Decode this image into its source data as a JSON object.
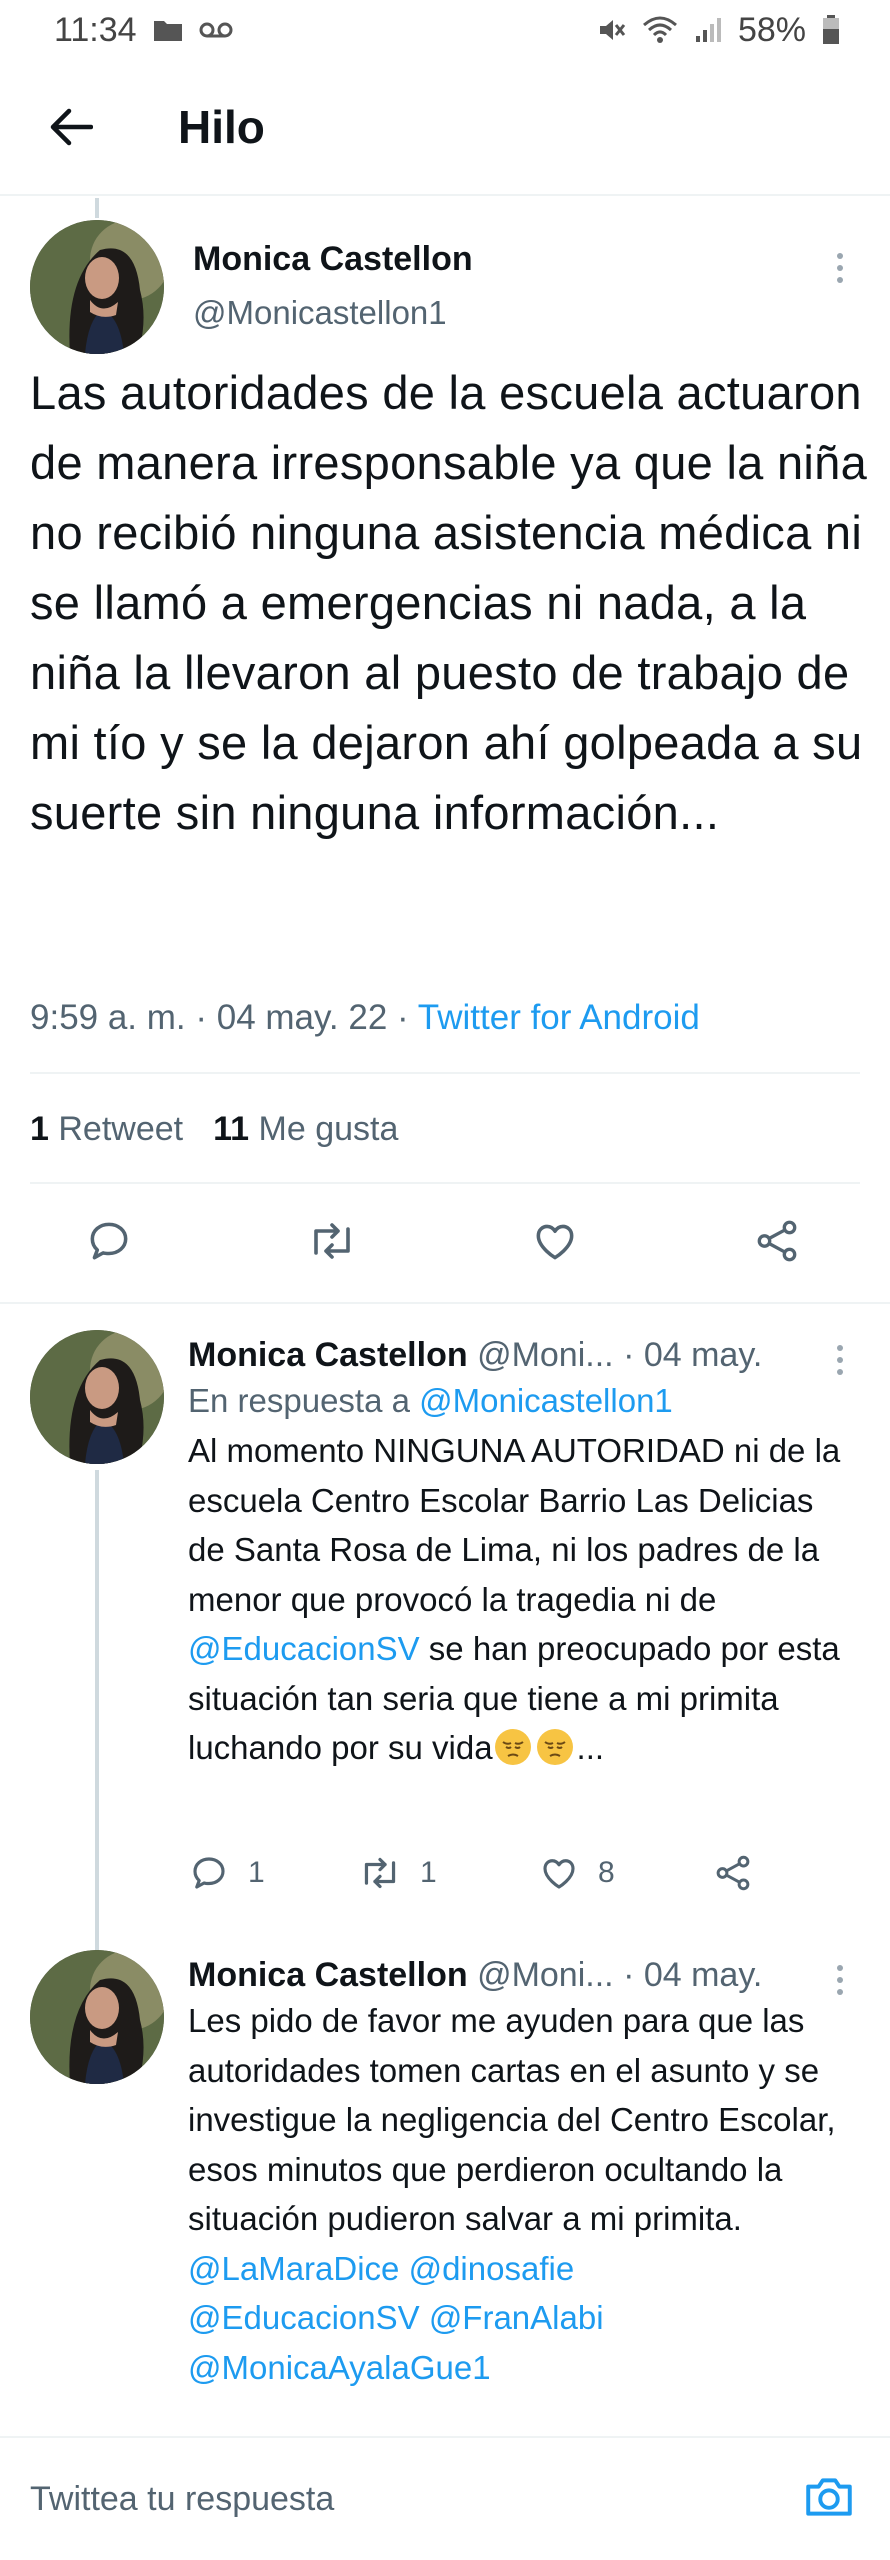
{
  "status_bar": {
    "time": "11:34",
    "battery": "58%"
  },
  "header": {
    "title": "Hilo"
  },
  "main_tweet": {
    "name": "Monica Castellon",
    "handle": "@Monicastellon1",
    "text": "Las autoridades de la escuela actuaron de manera irresponsable ya que la niña no recibió ninguna asistencia médica ni se llamó a emergencias ni nada, a la niña la llevaron al puesto de trabajo de mi tío y se la dejaron ahí golpeada a su suerte sin ninguna información...",
    "time": "9:59 a. m. · 04 may. 22 · ",
    "source": "Twitter for Android",
    "retweets_count": "1",
    "retweets_label": "Retweet",
    "likes_count": "11",
    "likes_label": "Me gusta"
  },
  "replies": [
    {
      "name": "Monica Castellon",
      "handle": "@Moni...",
      "date": " · 04 may.",
      "in_reply_prefix": "En respuesta a ",
      "in_reply_handle": "@Monicastellon1",
      "text_part1": "Al momento NINGUNA AUTORIDAD ni de la escuela Centro Escolar Barrio Las Delicias de Santa Rosa de Lima, ni los padres de la menor que provocó la tragedia ni de ",
      "mention": "@EducacionSV",
      "text_part2": " se han preocupado por esta situación tan seria que tiene a mi primita luchando por su vida",
      "text_end": "...",
      "reply_count": "1",
      "retweet_count": "1",
      "like_count": "8"
    },
    {
      "name": "Monica Castellon",
      "handle": "@Moni...",
      "date": " · 04 may.",
      "text": "Les pido de favor me ayuden para que las autoridades tomen cartas en el asunto y se investigue la negligencia del Centro Escolar, esos minutos que perdieron ocultando la situación pudieron salvar a mi primita.",
      "mentions_line1_a": "@LaMaraDice",
      "mentions_line1_b": "@dinosafie",
      "mentions_line2_a": "@EducacionSV",
      "mentions_line2_b": "@FranAlabi",
      "mentions_line3": "@MonicaAyalaGue1"
    }
  ],
  "reply_bar": {
    "placeholder": "Twittea tu respuesta"
  },
  "colors": {
    "accent": "#1d9bf0",
    "secondary_text": "#536471",
    "divider": "#eff3f4"
  },
  "icons": [
    "folder-icon",
    "voicemail-icon",
    "mute-icon",
    "wifi-icon",
    "signal-icon",
    "battery-icon",
    "back-arrow-icon",
    "more-icon",
    "reply-icon",
    "retweet-icon",
    "like-icon",
    "share-icon",
    "camera-icon",
    "pensive-emoji-icon"
  ]
}
